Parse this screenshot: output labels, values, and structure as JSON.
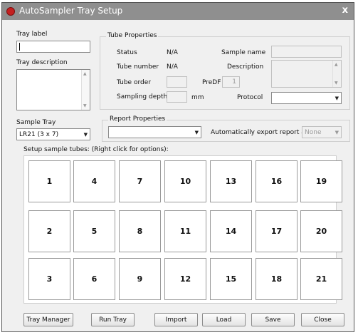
{
  "window": {
    "title": "AutoSampler Tray Setup",
    "close_glyph": "x"
  },
  "tray_label": {
    "label": "Tray label",
    "value": ""
  },
  "tray_description": {
    "label": "Tray description",
    "value": ""
  },
  "tube_properties": {
    "title": "Tube Properties",
    "status_label": "Status",
    "status_value": "N/A",
    "tube_number_label": "Tube number",
    "tube_number_value": "N/A",
    "tube_order_label": "Tube order",
    "tube_order_value": "",
    "predf_label": "PreDF",
    "predf_value": "1",
    "sampling_depth_label": "Sampling depth",
    "sampling_depth_value": "",
    "sampling_depth_unit": "mm",
    "sample_name_label": "Sample name",
    "sample_name_value": "",
    "description_label": "Description",
    "description_value": "",
    "protocol_label": "Protocol",
    "protocol_value": ""
  },
  "sample_tray": {
    "label": "Sample Tray",
    "value": "LR21 (3 x 7)"
  },
  "report_properties": {
    "title": "Report Properties",
    "report_value": "",
    "auto_export_label": "Automatically export report as:",
    "auto_export_value": "None"
  },
  "setup_label": "Setup sample tubes: (Right click for options):",
  "tubes": [
    [
      "1",
      "4",
      "7",
      "10",
      "13",
      "16",
      "19"
    ],
    [
      "2",
      "5",
      "8",
      "11",
      "14",
      "17",
      "20"
    ],
    [
      "3",
      "6",
      "9",
      "12",
      "15",
      "18",
      "21"
    ]
  ],
  "buttons": {
    "tray_manager": "Tray Manager",
    "run_tray": "Run Tray",
    "import": "Import",
    "load": "Load",
    "save": "Save",
    "close": "Close"
  },
  "colors": {
    "titlebar": "#8f8f8f",
    "window_bg": "#f0f0f0",
    "app_icon": "#c42020"
  },
  "icons": {
    "app": "app-icon",
    "dropdown": "chevron-down-icon",
    "close": "close-icon"
  }
}
